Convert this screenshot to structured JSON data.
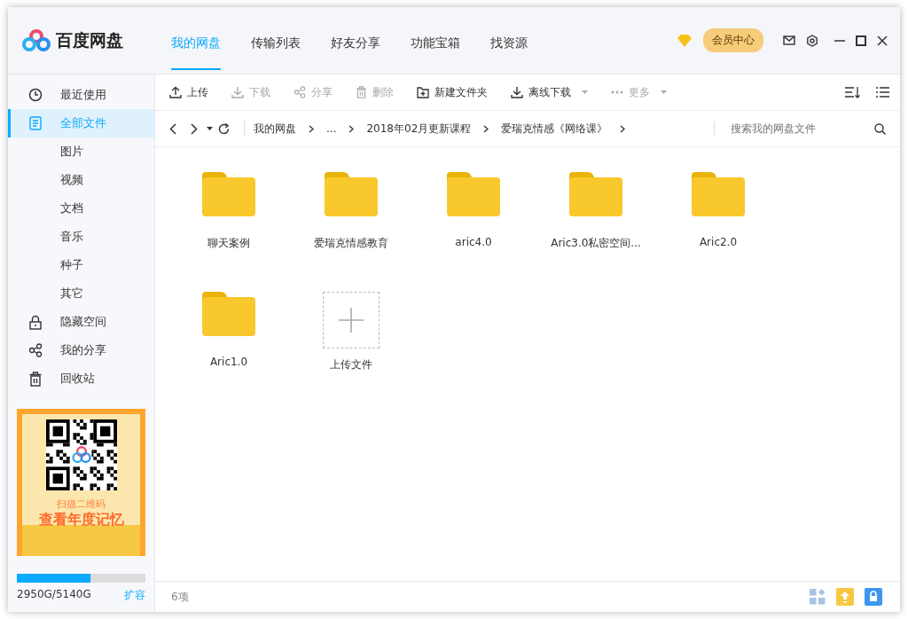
{
  "app": {
    "name": "百度网盘"
  },
  "nav_tabs": [
    {
      "label": "我的网盘",
      "selected": true
    },
    {
      "label": "传输列表",
      "selected": false
    },
    {
      "label": "好友分享",
      "selected": false
    },
    {
      "label": "功能宝箱",
      "selected": false
    },
    {
      "label": "找资源",
      "selected": false
    }
  ],
  "member_button": "会员中心",
  "sidebar": {
    "items": [
      {
        "label": "最近使用",
        "kind": "main",
        "selected": false
      },
      {
        "label": "全部文件",
        "kind": "main",
        "selected": true
      },
      {
        "label": "图片",
        "kind": "sub",
        "selected": false
      },
      {
        "label": "视频",
        "kind": "sub",
        "selected": false
      },
      {
        "label": "文档",
        "kind": "sub",
        "selected": false
      },
      {
        "label": "音乐",
        "kind": "sub",
        "selected": false
      },
      {
        "label": "种子",
        "kind": "sub",
        "selected": false
      },
      {
        "label": "其它",
        "kind": "sub",
        "selected": false
      },
      {
        "label": "隐藏空间",
        "kind": "main",
        "selected": false
      },
      {
        "label": "我的分享",
        "kind": "main",
        "selected": false
      },
      {
        "label": "回收站",
        "kind": "main",
        "selected": false
      }
    ],
    "promo": {
      "line1": "扫描二维码",
      "line2": "查看年度记忆"
    },
    "storage": {
      "level": 0.574,
      "reading": "2950G/5140G",
      "expand_link": "扩容"
    }
  },
  "toolbar": [
    {
      "label": "上传",
      "disabled": false,
      "dropdown": false
    },
    {
      "label": "下载",
      "disabled": true,
      "dropdown": false
    },
    {
      "label": "分享",
      "disabled": true,
      "dropdown": false
    },
    {
      "label": "删除",
      "disabled": true,
      "dropdown": false
    },
    {
      "label": "新建文件夹",
      "disabled": false,
      "dropdown": false
    },
    {
      "label": "离线下载",
      "disabled": false,
      "dropdown": true
    },
    {
      "label": "更多",
      "disabled": true,
      "dropdown": true
    }
  ],
  "breadcrumb": [
    "我的网盘",
    "...",
    "2018年02月更新课程",
    "爱瑞克情感《网络课》"
  ],
  "search": {
    "placeholder": "搜索我的网盘文件"
  },
  "files": [
    {
      "name": "聊天案例",
      "kind": "folder"
    },
    {
      "name": "爱瑞克情感教育",
      "kind": "folder"
    },
    {
      "name": "aric4.0",
      "kind": "folder"
    },
    {
      "name": "Aric3.0私密空间...",
      "kind": "folder"
    },
    {
      "name": "Aric2.0",
      "kind": "folder"
    },
    {
      "name": "Aric1.0",
      "kind": "folder"
    },
    {
      "name": "上传文件",
      "kind": "upload"
    }
  ],
  "status_bar": {
    "count": "6项"
  }
}
